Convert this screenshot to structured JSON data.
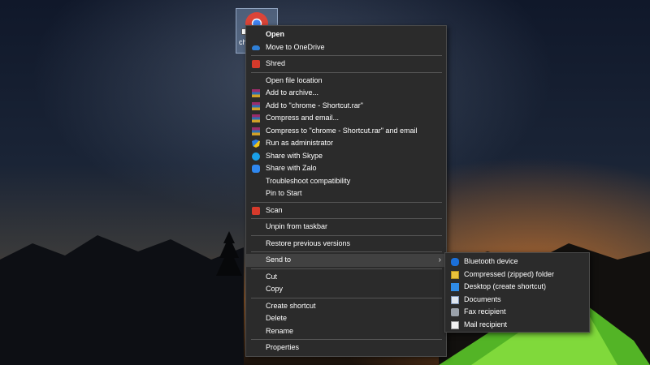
{
  "desktop": {
    "shortcut_label": "chrome - Shortcut"
  },
  "context_menu": {
    "open": "Open",
    "move_to_onedrive": "Move to OneDrive",
    "shred": "Shred",
    "open_file_location": "Open file location",
    "add_to_archive": "Add to archive...",
    "add_to_rar": "Add to \"chrome - Shortcut.rar\"",
    "compress_and_email": "Compress and email...",
    "compress_to_rar_email": "Compress to \"chrome - Shortcut.rar\" and email",
    "run_as_admin": "Run as administrator",
    "share_skype": "Share with Skype",
    "share_zalo": "Share with Zalo",
    "troubleshoot": "Troubleshoot compatibility",
    "pin_to_start": "Pin to Start",
    "scan": "Scan",
    "unpin_taskbar": "Unpin from taskbar",
    "restore_versions": "Restore previous versions",
    "send_to": "Send to",
    "cut": "Cut",
    "copy": "Copy",
    "create_shortcut": "Create shortcut",
    "delete": "Delete",
    "rename": "Rename",
    "properties": "Properties",
    "submenu_arrow": "›"
  },
  "send_to_menu": {
    "bluetooth": "Bluetooth device",
    "compressed": "Compressed (zipped) folder",
    "desktop": "Desktop (create shortcut)",
    "documents": "Documents",
    "fax": "Fax recipient",
    "mail": "Mail recipient"
  },
  "icons": {
    "chrome": "chrome-icon",
    "onedrive": "onedrive-icon",
    "shred": "shred-icon",
    "winrar": "winrar-icon",
    "shield": "uac-shield-icon",
    "skype": "skype-icon",
    "zalo": "zalo-icon",
    "scan": "scan-icon",
    "bluetooth": "bluetooth-icon",
    "zip": "zip-folder-icon",
    "desktop": "desktop-icon",
    "documents": "documents-icon",
    "fax": "fax-icon",
    "mail": "mail-icon"
  },
  "colors": {
    "menu_bg": "#2b2b2b",
    "menu_highlight": "#414141",
    "menu_text": "#ffffff"
  }
}
